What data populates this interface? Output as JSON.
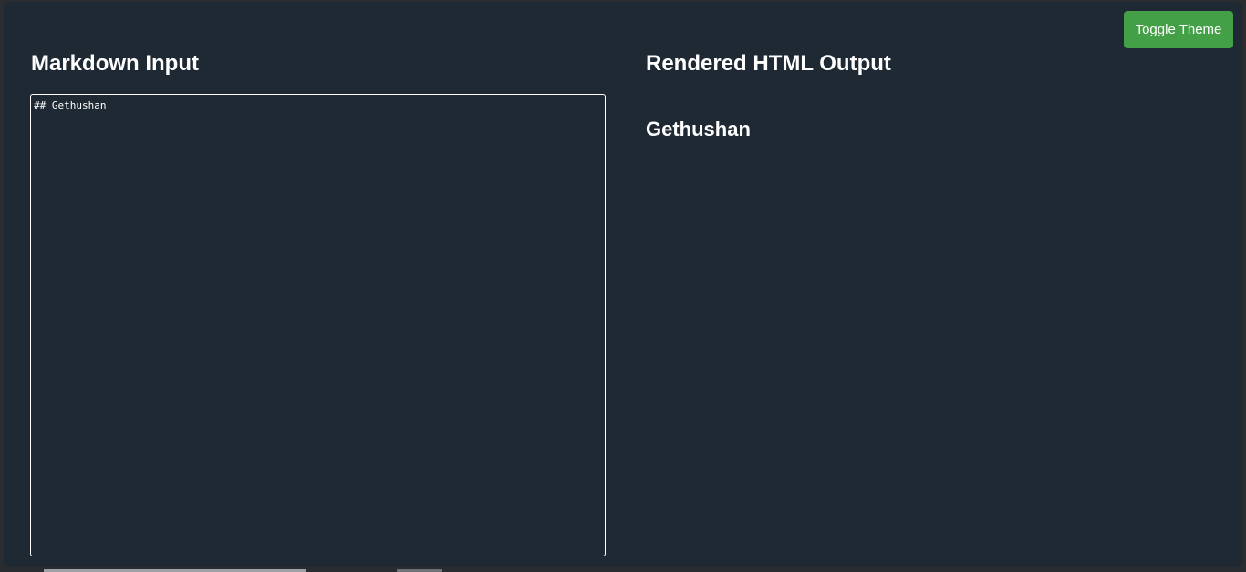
{
  "toolbar": {
    "toggle_theme_label": "Toggle Theme"
  },
  "input_pane": {
    "title": "Markdown Input",
    "editor_value": "## Gethushan"
  },
  "output_pane": {
    "title": "Rendered HTML Output",
    "rendered_heading": "Gethushan"
  },
  "colors": {
    "background": "#1e2933",
    "accent": "#43a047",
    "text": "#ffffff"
  }
}
